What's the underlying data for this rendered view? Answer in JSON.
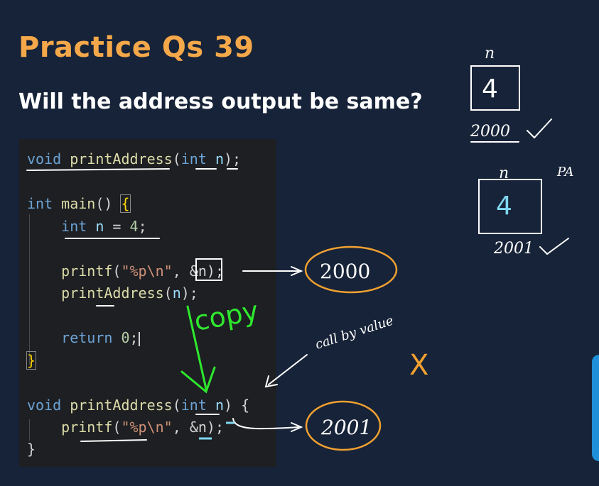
{
  "slide": {
    "title": "Practice Qs 39",
    "question": "Will the address output be same?"
  },
  "code": {
    "line1": {
      "kw1": "void",
      "fn": "printAddress",
      "p1": "(",
      "kw2": "int",
      "var": "n",
      "p2": ");"
    },
    "line2": {
      "kw": "int",
      "fn": "main",
      "p1": "()",
      "brace": "{"
    },
    "line3": {
      "kw": "int",
      "var": "n",
      "op": " = ",
      "num": "4",
      "end": ";"
    },
    "line4": {
      "fn": "printf",
      "p1": "(",
      "str": "\"%p\\n\"",
      "p2": ", ",
      "arg": "&n",
      "p3": ");"
    },
    "line5": {
      "fn": "printAddress",
      "p1": "(",
      "var": "n",
      "p2": ");"
    },
    "line6": {
      "kw": "return",
      "num": "0",
      "end": ";"
    },
    "line7": {
      "brace": "}"
    },
    "line8": {
      "kw1": "void",
      "fn": "printAddress",
      "p1": "(",
      "kw2": "int",
      "var": "n",
      "p2": ") {"
    },
    "line9": {
      "fn": "printf",
      "p1": "(",
      "str": "\"%p\\n\"",
      "p2": ", ",
      "arg": "&n",
      "p3": ");"
    },
    "line10": {
      "brace": "}"
    }
  },
  "annotations": {
    "output_main": "2000",
    "output_func": "2001",
    "copy": "copy",
    "call_by_value": "call by value",
    "cross": "X",
    "diagram_top": {
      "var": "n",
      "value": "4",
      "address": "2000"
    },
    "diagram_bottom": {
      "var": "n",
      "label": "PA",
      "value": "4",
      "address": "2001"
    }
  },
  "colors": {
    "background": "#172338",
    "title": "#f5a84a",
    "code_bg": "#1e1f22",
    "ink_white": "#ffffff",
    "ink_orange": "#f0a030",
    "ink_green": "#2ee82e",
    "ink_cyan": "#7fd8f0"
  }
}
